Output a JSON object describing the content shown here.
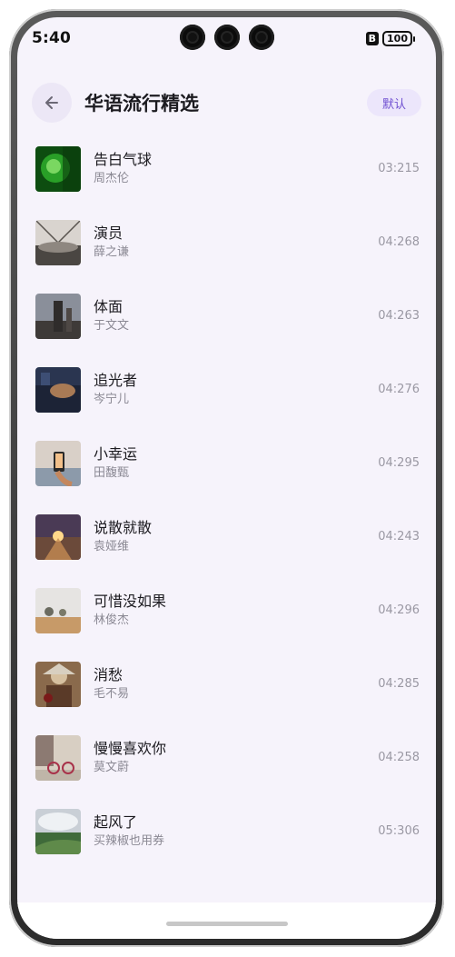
{
  "status": {
    "time": "5:40",
    "sim": "B",
    "battery": "100"
  },
  "header": {
    "title": "华语流行精选",
    "default_label": "默认"
  },
  "songs": [
    {
      "title": "告白气球",
      "artist": "周杰伦",
      "duration": "03:215"
    },
    {
      "title": "演员",
      "artist": "薛之谦",
      "duration": "04:268"
    },
    {
      "title": "体面",
      "artist": "于文文",
      "duration": "04:263"
    },
    {
      "title": "追光者",
      "artist": "岑宁儿",
      "duration": "04:276"
    },
    {
      "title": "小幸运",
      "artist": "田馥甄",
      "duration": "04:295"
    },
    {
      "title": "说散就散",
      "artist": "袁娅维",
      "duration": "04:243"
    },
    {
      "title": "可惜没如果",
      "artist": "林俊杰",
      "duration": "04:296"
    },
    {
      "title": "消愁",
      "artist": "毛不易",
      "duration": "04:285"
    },
    {
      "title": "慢慢喜欢你",
      "artist": "莫文蔚",
      "duration": "04:258"
    },
    {
      "title": "起风了",
      "artist": "买辣椒也用券",
      "duration": "05:306"
    }
  ],
  "colors": {
    "accent": "#6f4fd1",
    "background": "#f6f3fb",
    "default_bg": "#ece6fb"
  }
}
